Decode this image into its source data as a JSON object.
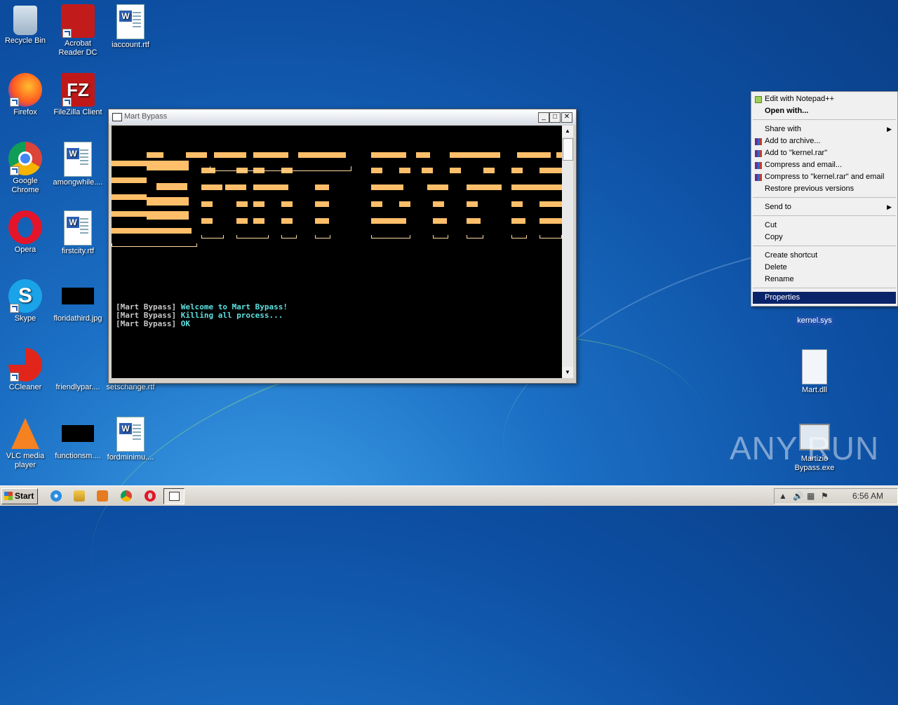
{
  "desktop_icons": {
    "recycle_bin": "Recycle Bin",
    "acrobat": "Acrobat Reader DC",
    "iaccount": "iaccount.rtf",
    "firefox": "Firefox",
    "filezilla": "FileZilla Client",
    "chrome": "Google Chrome",
    "amongwhile": "amongwhile....",
    "opera": "Opera",
    "firstcity": "firstcity.rtf",
    "skype": "Skype",
    "floridathird": "floridathird.jpg",
    "ccleaner": "CCleaner",
    "friendlypar": "friendlypar....",
    "setschange": "setschange.rtf",
    "vlc": "VLC media player",
    "functionsm": "functionsm....",
    "fordminimu": "fordminimu....",
    "kernel": "kernel.sys",
    "mart_dll": "Mart.dll",
    "mart_bypass": "Martizio Bypass.exe"
  },
  "console_window": {
    "title": "Mart Bypass",
    "log": [
      {
        "tag": "[Mart Bypass]",
        "msg": "Welcome to Mart Bypass!"
      },
      {
        "tag": "[Mart Bypass]",
        "msg": "Killing all process..."
      },
      {
        "tag": "[Mart Bypass]",
        "msg": "OK"
      }
    ],
    "colors": {
      "banner": "#ffbf6a",
      "message": "#5ee0e0",
      "tag": "#c8c8c8"
    }
  },
  "context_menu": {
    "items": [
      {
        "label": "Edit with Notepad++",
        "icon": "notepadpp-icon"
      },
      {
        "label": "Open with...",
        "bold": true
      },
      {
        "label": "Share with",
        "submenu": true
      },
      {
        "label": "Add to archive...",
        "icon": "winrar-icon"
      },
      {
        "label": "Add to \"kernel.rar\"",
        "icon": "winrar-icon"
      },
      {
        "label": "Compress and email...",
        "icon": "winrar-icon"
      },
      {
        "label": "Compress to \"kernel.rar\" and email",
        "icon": "winrar-icon"
      },
      {
        "label": "Restore previous versions"
      },
      {
        "label": "Send to",
        "submenu": true
      },
      {
        "label": "Cut"
      },
      {
        "label": "Copy"
      },
      {
        "label": "Create shortcut"
      },
      {
        "label": "Delete"
      },
      {
        "label": "Rename"
      },
      {
        "label": "Properties",
        "highlighted": true
      }
    ]
  },
  "taskbar": {
    "start_label": "Start",
    "clock": "6:56 AM"
  },
  "watermark": "ANY RUN"
}
